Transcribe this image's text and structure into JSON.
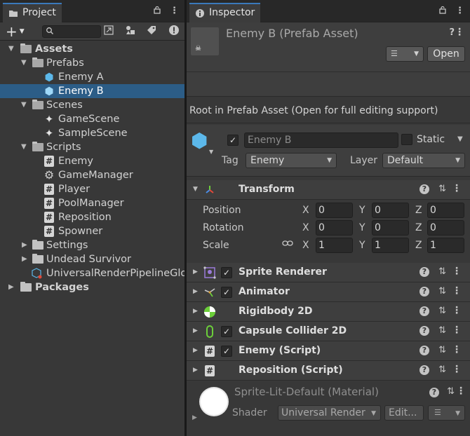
{
  "project": {
    "tab_label": "Project",
    "tree": [
      {
        "label": "Assets",
        "depth": 0,
        "type": "folder",
        "expanded": true,
        "bold": true
      },
      {
        "label": "Prefabs",
        "depth": 1,
        "type": "folder",
        "expanded": true
      },
      {
        "label": "Enemy A",
        "depth": 2,
        "type": "prefab"
      },
      {
        "label": "Enemy B",
        "depth": 2,
        "type": "prefab",
        "selected": true
      },
      {
        "label": "Scenes",
        "depth": 1,
        "type": "folder",
        "expanded": true
      },
      {
        "label": "GameScene",
        "depth": 2,
        "type": "scene"
      },
      {
        "label": "SampleScene",
        "depth": 2,
        "type": "scene"
      },
      {
        "label": "Scripts",
        "depth": 1,
        "type": "folder",
        "expanded": true
      },
      {
        "label": "Enemy",
        "depth": 2,
        "type": "script"
      },
      {
        "label": "GameManager",
        "depth": 2,
        "type": "gear"
      },
      {
        "label": "Player",
        "depth": 2,
        "type": "script"
      },
      {
        "label": "PoolManager",
        "depth": 2,
        "type": "script"
      },
      {
        "label": "Reposition",
        "depth": 2,
        "type": "script"
      },
      {
        "label": "Spowner",
        "depth": 2,
        "type": "script"
      },
      {
        "label": "Settings",
        "depth": 1,
        "type": "folder",
        "expanded": false
      },
      {
        "label": "Undead Survivor",
        "depth": 1,
        "type": "folder",
        "expanded": false
      },
      {
        "label": "UniversalRenderPipelineGlo",
        "depth": 1,
        "type": "asset"
      },
      {
        "label": "Packages",
        "depth": 0,
        "type": "folder",
        "expanded": false,
        "bold": true
      }
    ]
  },
  "inspector": {
    "tab_label": "Inspector",
    "asset_title": "Enemy B (Prefab Asset)",
    "open_label": "Open",
    "root_message": "Root in Prefab Asset (Open for full editing support)",
    "gameobject": {
      "name": "Enemy B",
      "static_label": "Static",
      "tag_label": "Tag",
      "tag_value": "Enemy",
      "layer_label": "Layer",
      "layer_value": "Default"
    },
    "transform": {
      "name": "Transform",
      "position_label": "Position",
      "rotation_label": "Rotation",
      "scale_label": "Scale",
      "position": {
        "x": "0",
        "y": "0",
        "z": "0"
      },
      "rotation": {
        "x": "0",
        "y": "0",
        "z": "0"
      },
      "scale": {
        "x": "1",
        "y": "1",
        "z": "1"
      },
      "axis_x": "X",
      "axis_y": "Y",
      "axis_z": "Z"
    },
    "components": [
      {
        "name": "Sprite Renderer",
        "icon": "sprite-renderer-icon",
        "checkbox": true
      },
      {
        "name": "Animator",
        "icon": "animator-icon",
        "checkbox": true
      },
      {
        "name": "Rigidbody 2D",
        "icon": "rigidbody-icon",
        "checkbox": false
      },
      {
        "name": "Capsule Collider 2D",
        "icon": "capsule-collider-icon",
        "checkbox": true
      },
      {
        "name": "Enemy (Script)",
        "icon": "script-icon",
        "checkbox": true
      },
      {
        "name": "Reposition (Script)",
        "icon": "script-icon",
        "checkbox": false
      }
    ],
    "material": {
      "name": "Sprite-Lit-Default (Material)",
      "shader_label": "Shader",
      "shader_value": "Universal Render",
      "edit_label": "Edit..."
    }
  },
  "colors": {
    "selection": "#2c5d87",
    "accent_tab": "#3a79bb",
    "prefab_blue": "#5cb8ea"
  }
}
